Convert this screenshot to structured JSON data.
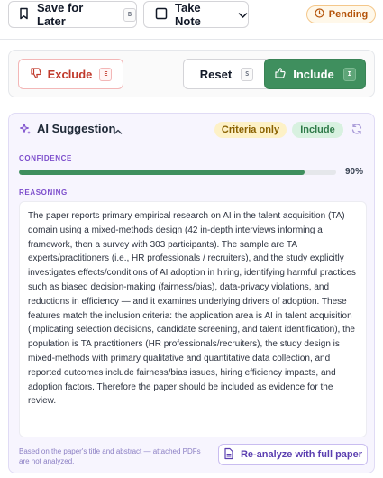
{
  "toolbar": {
    "save_label": "Save for Later",
    "save_shortcut": "B",
    "note_label": "Take Note",
    "status_label": "Pending",
    "status_color": "#b45309"
  },
  "decision": {
    "exclude_label": "Exclude",
    "exclude_shortcut": "E",
    "reset_label": "Reset",
    "reset_shortcut": "S",
    "include_label": "Include",
    "include_shortcut": "I",
    "include_color": "#3f8f5e",
    "exclude_color": "#c0392b"
  },
  "suggestion": {
    "title": "AI Suggestion",
    "badge_criteria": "Criteria only",
    "badge_verdict": "Include",
    "confidence_label": "CONFIDENCE",
    "confidence_value": 0.9,
    "confidence_text": "90%",
    "reasoning_label": "REASONING",
    "reasoning_text": "The paper reports primary empirical research on AI in the talent acquisition (TA) domain using a mixed-methods design (42 in-depth interviews informing a framework, then a survey with 303 participants). The sample are TA experts/practitioners (i.e., HR professionals / recruiters), and the study explicitly investigates effects/conditions of AI adoption in hiring, identifying harmful practices such as biased decision-making (fairness/bias), data-privacy violations, and reductions in efficiency — and it examines underlying drivers of adoption. These features match the inclusion criteria: the application area is AI in talent acquisition (implicating selection decisions, candidate screening, and talent identification), the population is TA practitioners (HR professionals/recruiters), the study design is mixed-methods with primary qualitative and quantitative data collection, and reported outcomes include fairness/bias issues, hiring efficiency impacts, and adoption factors. Therefore the paper should be included as evidence for the review.",
    "footnote": "Based on the paper's title and abstract — attached PDFs are not analyzed.",
    "reanalyze_label": "Re-analyze with full paper"
  },
  "icons": {
    "save": "bookmark-icon",
    "note": "note-icon",
    "note_menu": "chevron-down-icon",
    "status": "clock-icon",
    "exclude": "thumbs-down-icon",
    "include": "thumbs-up-icon",
    "suggestion": "sparkle-icon",
    "collapse": "chevron-up-icon",
    "refresh": "refresh-icon",
    "reanalyze": "document-icon"
  }
}
